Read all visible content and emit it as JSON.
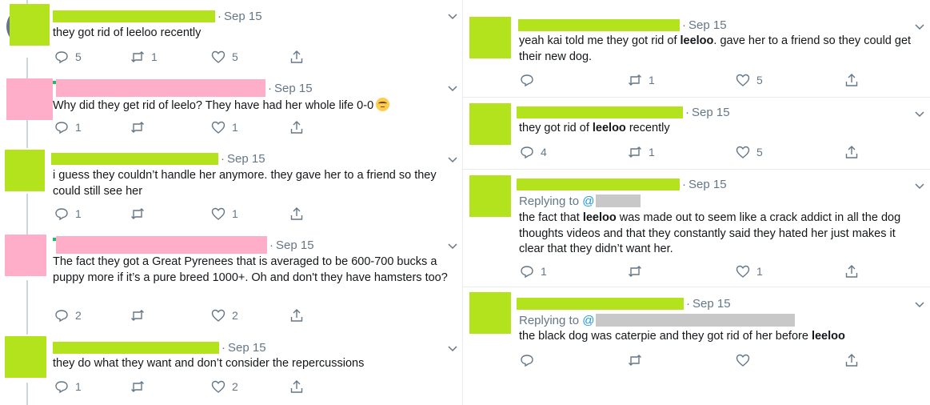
{
  "colors": {
    "avatar_green": "#b3e31c",
    "avatar_pink": "#ffaec9",
    "name_green": "#b3e31c",
    "name_pink": "#ffaec9",
    "handle_gray": "#c8c8c8",
    "muted": "#657786",
    "link": "#1b95e0"
  },
  "left_tweets": [
    {
      "date": "Sep 15",
      "segments": [
        "they got rid of leeloo recently"
      ],
      "replies": "5",
      "retweets": "1",
      "likes": "5"
    },
    {
      "date": "Sep 15",
      "segments": [
        "Why did they get rid of leelo? They have had her whole life 0-0"
      ],
      "emoji": "face-emoji",
      "replies": "1",
      "retweets": "",
      "likes": "1"
    },
    {
      "date": "Sep 15",
      "segments": [
        "i guess they couldn’t handle her anymore. they gave her to a friend so they could still see her"
      ],
      "replies": "1",
      "retweets": "",
      "likes": "1"
    },
    {
      "date": "Sep 15",
      "segments": [
        "The fact they got a Great Pyrenees that is averaged to be 600-700 bucks a puppy more if it’s a pure breed 1000+. Oh and don't they have hamsters too?"
      ],
      "replies": "2",
      "retweets": "",
      "likes": "2"
    },
    {
      "date": "Sep 15",
      "segments": [
        "they do what they want and don’t consider the repercussions"
      ],
      "replies": "1",
      "retweets": "",
      "likes": "2"
    }
  ],
  "right_tweets": [
    {
      "date": "Sep 15",
      "replying": "",
      "segments": [
        "yeah kai told me they got rid of ",
        "leeloo",
        ". gave her to a friend so they could get their new dog."
      ],
      "replies": "",
      "retweets": "1",
      "likes": "5"
    },
    {
      "date": "Sep 15",
      "replying": "",
      "segments": [
        "they got rid of ",
        "leeloo",
        " recently"
      ],
      "replies": "4",
      "retweets": "1",
      "likes": "5"
    },
    {
      "date": "Sep 15",
      "replying": "Replying to",
      "at": "@",
      "segments": [
        "the fact that ",
        "leeloo",
        " was made out to seem like a crack addict in all the dog thoughts videos and that they constantly said they hated her just makes it clear that they didn’t want her."
      ],
      "replies": "1",
      "retweets": "",
      "likes": "1"
    },
    {
      "date": "Sep 15",
      "replying": "Replying to",
      "at": "@",
      "segments": [
        "the black dog was caterpie and they got rid of her before ",
        "leeloo",
        ""
      ],
      "replies": "",
      "retweets": "",
      "likes": ""
    }
  ]
}
